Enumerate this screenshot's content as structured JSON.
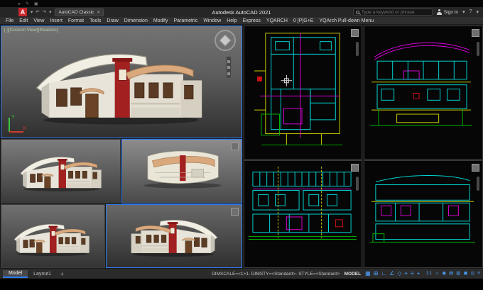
{
  "topstrip": {
    "icons": [
      "▸",
      "✎",
      "▣"
    ]
  },
  "titlebar": {
    "logo_letter": "A",
    "qat_icons": [
      "▾",
      "↶",
      "↷",
      "▾"
    ],
    "workspace_label": "AutoCAD Classic",
    "workspace_close": "✕",
    "app_title": "Autodesk AutoCAD 2021",
    "search_placeholder": "Type a keyword or phrase",
    "signin_label": "Sign In",
    "right_icons": [
      "▾",
      "?",
      "▾"
    ]
  },
  "menubar": {
    "items": [
      "File",
      "Edit",
      "View",
      "Insert",
      "Format",
      "Tools",
      "Draw",
      "Dimension",
      "Modify",
      "Parametric",
      "Window",
      "Help",
      "Express",
      "YQARCH",
      "0 [P]G+E",
      "YQArch Pull-down Menu"
    ]
  },
  "viewports": {
    "main_label": "[-][Custom View][Realistic]",
    "ucs_x": "X",
    "ucs_y": "Y"
  },
  "tabs": {
    "model": "Model",
    "layout": "Layout1",
    "add": "+"
  },
  "statusbar": {
    "left_text": "DIMSCALE=<1>1-  DIMSTY=<Standard>-  STYLE=<Standard>",
    "model_label": "MODEL",
    "left_icons": [
      {
        "name": "grid",
        "glyph": "▦"
      },
      {
        "name": "snap",
        "glyph": "⊞"
      },
      {
        "name": "ortho",
        "glyph": "∟"
      },
      {
        "name": "polar",
        "glyph": "∠"
      },
      {
        "name": "isodraft",
        "glyph": "◇"
      },
      {
        "name": "osnap",
        "glyph": "⌖"
      },
      {
        "name": "lineweight",
        "glyph": "≡"
      },
      {
        "name": "dyninput",
        "glyph": "+"
      }
    ],
    "right_icons": [
      {
        "name": "annotation-scale",
        "glyph": "1:1"
      },
      {
        "name": "workspace",
        "glyph": "☼"
      },
      {
        "name": "annotation-monitor",
        "glyph": "◉"
      },
      {
        "name": "units",
        "glyph": "▤"
      },
      {
        "name": "quick-properties",
        "glyph": "▥"
      },
      {
        "name": "hardware-accel",
        "glyph": "▣"
      },
      {
        "name": "isolate",
        "glyph": "◎"
      },
      {
        "name": "customization",
        "glyph": "≡"
      }
    ]
  }
}
